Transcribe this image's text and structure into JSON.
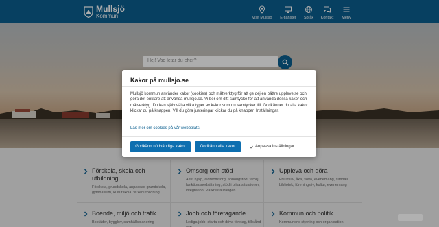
{
  "header": {
    "logo_name": "Mullsjö",
    "logo_sub": "Kommun",
    "nav": [
      {
        "label": "Visit Mullsjö",
        "icon": "map-pin-icon"
      },
      {
        "label": "E-tjänster",
        "icon": "monitor-icon"
      },
      {
        "label": "Språk",
        "icon": "globe-icon"
      },
      {
        "label": "Kontakt",
        "icon": "chat-icon"
      },
      {
        "label": "Meny",
        "icon": "menu-icon"
      }
    ]
  },
  "search": {
    "placeholder": "Hej! Vad letar du efter?"
  },
  "tiles": [
    {
      "title": "Förskola, skola och utbildning",
      "desc": "Förskola, grundskola, anpassad grundskola, gymnasium, kulturskola, vuxenutbildning"
    },
    {
      "title": "Omsorg och stöd",
      "desc": "Akut hjälp, äldreomsorg, anhörigstöd, familj, funktionsnedsättning, stöd i olika situationer, integration, Parkrestaurangen"
    },
    {
      "title": "Uppleva och göra",
      "desc": "Friluftsliv, åka, sova, evenemang, simhall, bibliotek, föreningsliv, kultur, evenemang"
    },
    {
      "title": "Boende, miljö och trafik",
      "desc": "Bostäder, bygglov, samhällsplanering"
    },
    {
      "title": "Jobb och företagande",
      "desc": "Lediga jobb, starta och driva företag, tillstånd och"
    },
    {
      "title": "Kommun och politik",
      "desc": "Kommunens styrning och organisation,"
    }
  ],
  "modal": {
    "title": "Kakor på mullsjo.se",
    "body": "Mullsjö kommun använder kakor (cookies) och mätverktyg för att ge dej en bättre upplevelse och göra det enklare att använda mullsjo.se. Vi ber om ditt samtycke för att använda dessa kakor och mätverktyg. Du kan själv välja vilka typer av kakor som du samtycker till. Godkänner du alla kakor klickar du på knappen. Vill du göra justeringar klickar du på knappen Inställningar.",
    "link": "Läs mer om cookies på vår webbplats",
    "btn_necessary": "Godkänn nödvändiga kakor",
    "btn_all": "Godkänn alla kakor",
    "btn_customize": "Anpassa inställningar"
  },
  "colors": {
    "brand": "#0b5f8f",
    "button": "#0e6fb0"
  }
}
